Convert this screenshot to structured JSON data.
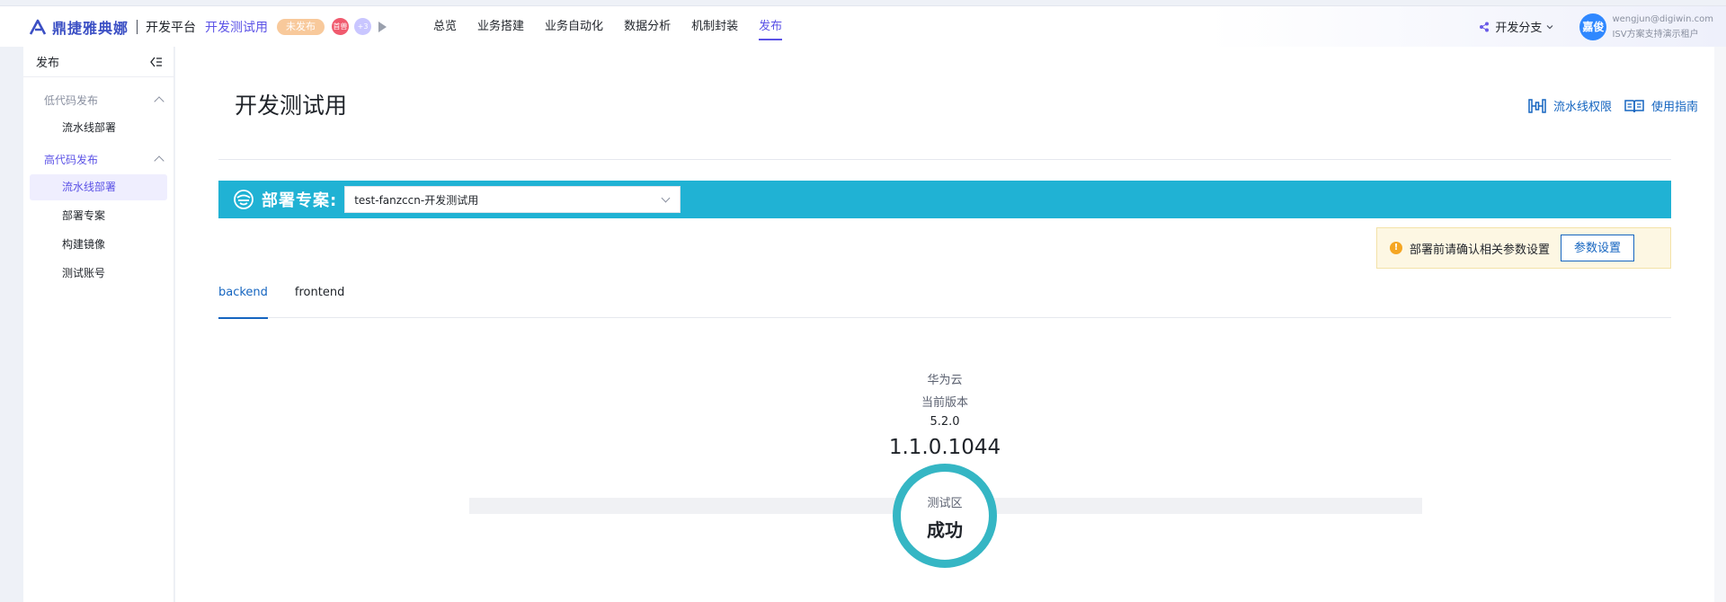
{
  "header": {
    "brand": "鼎捷雅典娜",
    "platform": "开发平台",
    "app_name": "开发测试用",
    "publish_status": "未发布",
    "avatar_red_label": "首兽",
    "avatar_violet_label": "+3",
    "nav": [
      "总览",
      "业务搭建",
      "业务自动化",
      "数据分析",
      "机制封装",
      "发布"
    ],
    "active_nav": "发布",
    "branch_label": "开发分支",
    "user": {
      "avatar_text": "嘉俊",
      "email": "wengjun@digiwin.com",
      "tenant": "ISV方案支持演示租户"
    },
    "accent_color": "#5b52e6"
  },
  "sidebar": {
    "title": "发布",
    "groups": [
      {
        "label": "低代码发布",
        "items": [
          "流水线部署"
        ]
      },
      {
        "label": "高代码发布",
        "items": [
          "流水线部署",
          "部署专案",
          "构建镜像",
          "测试账号"
        ]
      }
    ],
    "active_item": "高代码发布/流水线部署"
  },
  "main": {
    "title": "开发测试用",
    "links": {
      "pipeline_permission": "流水线权限",
      "guide": "使用指南"
    },
    "deploy": {
      "label": "部署专案:",
      "selected": "test-fanzccn-开发测试用",
      "bar_color": "#20b2d4"
    },
    "notice": {
      "text": "部署前请确认相关参数设置",
      "button": "参数设置"
    },
    "tabs": [
      "backend",
      "frontend"
    ],
    "active_tab": "backend",
    "environment": {
      "cloud": "华为云",
      "current_version_label": "当前版本",
      "current_version": "5.2.0",
      "build_version": "1.1.0.1044",
      "stage_name": "测试区",
      "stage_status": "成功",
      "stage_color": "#35b6c4"
    }
  }
}
